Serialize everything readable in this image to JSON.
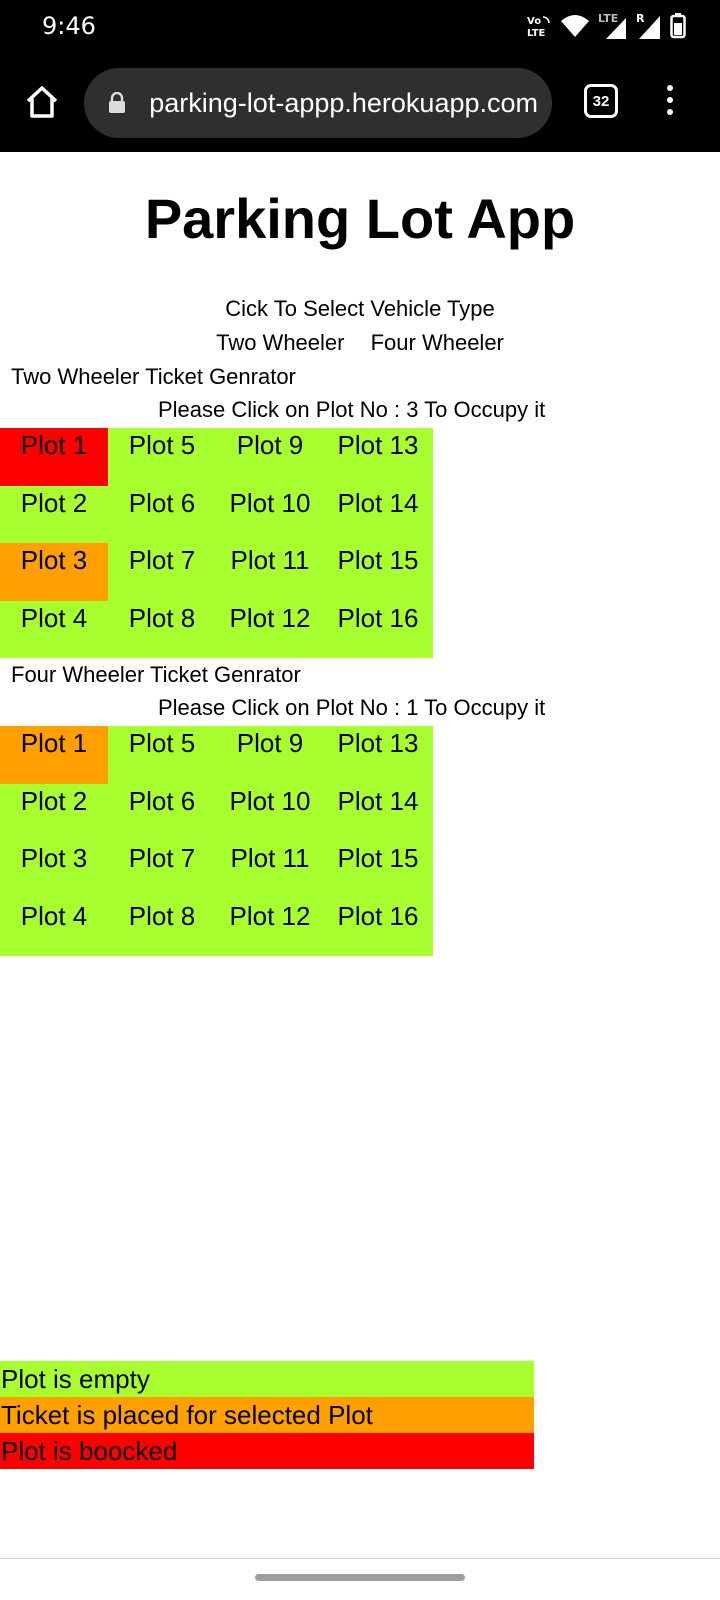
{
  "status_bar": {
    "time": "9:46",
    "icons": [
      "volte-icon",
      "wifi-icon",
      "lte-signal-icon",
      "roaming-signal-icon",
      "battery-icon"
    ],
    "volte_label": "Vo LTE",
    "lte_label": "LTE",
    "roaming_label": "R"
  },
  "browser": {
    "url": "parking-lot-appp.herokuapp.com",
    "tab_count": "32"
  },
  "page": {
    "title": "Parking Lot App",
    "select_prompt": "Cick To Select Vehicle Type",
    "vehicle_types": [
      "Two Wheeler",
      "Four Wheeler"
    ],
    "two_wheeler": {
      "heading": "Two Wheeler Ticket Genrator",
      "instruction": "Please Click on Plot No : 3 To Occupy it",
      "plots": [
        {
          "label": "Plot 1",
          "status": "booked"
        },
        {
          "label": "Plot 5",
          "status": "empty"
        },
        {
          "label": "Plot 9",
          "status": "empty"
        },
        {
          "label": "Plot 13",
          "status": "empty"
        },
        {
          "label": "Plot 2",
          "status": "empty"
        },
        {
          "label": "Plot 6",
          "status": "empty"
        },
        {
          "label": "Plot 10",
          "status": "empty"
        },
        {
          "label": "Plot 14",
          "status": "empty"
        },
        {
          "label": "Plot 3",
          "status": "selected"
        },
        {
          "label": "Plot 7",
          "status": "empty"
        },
        {
          "label": "Plot 11",
          "status": "empty"
        },
        {
          "label": "Plot 15",
          "status": "empty"
        },
        {
          "label": "Plot 4",
          "status": "empty"
        },
        {
          "label": "Plot 8",
          "status": "empty"
        },
        {
          "label": "Plot 12",
          "status": "empty"
        },
        {
          "label": "Plot 16",
          "status": "empty"
        }
      ]
    },
    "four_wheeler": {
      "heading": "Four Wheeler Ticket Genrator",
      "instruction": "Please Click on Plot No : 1 To Occupy it",
      "plots": [
        {
          "label": "Plot 1",
          "status": "selected"
        },
        {
          "label": "Plot 5",
          "status": "empty"
        },
        {
          "label": "Plot 9",
          "status": "empty"
        },
        {
          "label": "Plot 13",
          "status": "empty"
        },
        {
          "label": "Plot 2",
          "status": "empty"
        },
        {
          "label": "Plot 6",
          "status": "empty"
        },
        {
          "label": "Plot 10",
          "status": "empty"
        },
        {
          "label": "Plot 14",
          "status": "empty"
        },
        {
          "label": "Plot 3",
          "status": "empty"
        },
        {
          "label": "Plot 7",
          "status": "empty"
        },
        {
          "label": "Plot 11",
          "status": "empty"
        },
        {
          "label": "Plot 15",
          "status": "empty"
        },
        {
          "label": "Plot 4",
          "status": "empty"
        },
        {
          "label": "Plot 8",
          "status": "empty"
        },
        {
          "label": "Plot 12",
          "status": "empty"
        },
        {
          "label": "Plot 16",
          "status": "empty"
        }
      ]
    },
    "legend": [
      {
        "label": "Plot is empty",
        "color": "#a8ff2f"
      },
      {
        "label": "Ticket is placed for selected Plot",
        "color": "#ffa000"
      },
      {
        "label": "Plot is boocked",
        "color": "#ff0000"
      }
    ]
  },
  "colors": {
    "empty": "#a8ff2f",
    "selected": "#ffa000",
    "booked": "#ff0000"
  }
}
